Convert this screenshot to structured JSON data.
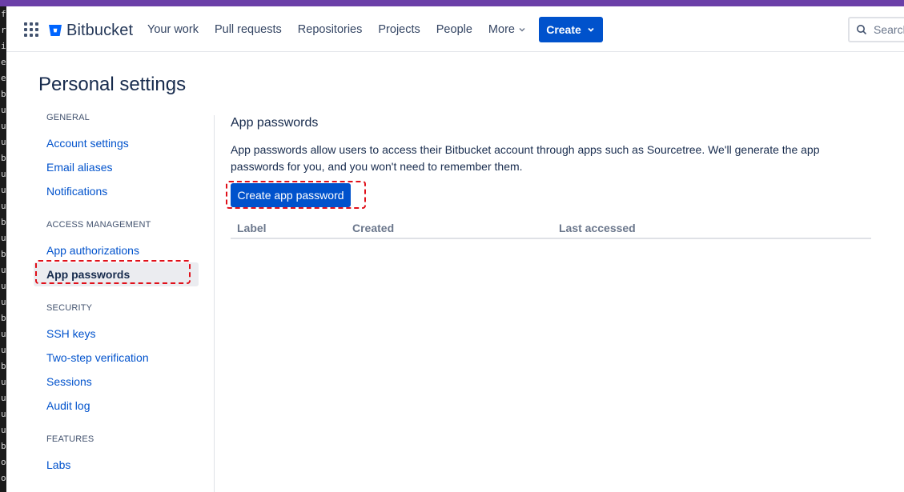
{
  "left_strip_chars": [
    "fa",
    "ro",
    "if",
    "e",
    "es",
    "b",
    "u",
    "u",
    "u",
    "b",
    "u",
    "u",
    "u",
    "b",
    "u",
    "b",
    "u",
    "u",
    "u",
    "b",
    "u",
    "u",
    "b",
    "u",
    "u",
    "u",
    "u",
    "b",
    "o",
    "o"
  ],
  "header": {
    "logo_text": "Bitbucket",
    "nav": [
      "Your work",
      "Pull requests",
      "Repositories",
      "Projects",
      "People"
    ],
    "more_label": "More",
    "create_label": "Create",
    "search_placeholder": "Search"
  },
  "page_title": "Personal settings",
  "sidebar": {
    "sections": [
      {
        "heading": "GENERAL",
        "items": [
          "Account settings",
          "Email aliases",
          "Notifications"
        ]
      },
      {
        "heading": "ACCESS MANAGEMENT",
        "items": [
          "App authorizations",
          "App passwords"
        ]
      },
      {
        "heading": "SECURITY",
        "items": [
          "SSH keys",
          "Two-step verification",
          "Sessions",
          "Audit log"
        ]
      },
      {
        "heading": "FEATURES",
        "items": [
          "Labs"
        ]
      }
    ],
    "active_item": "App passwords"
  },
  "content": {
    "title": "App passwords",
    "description": "App passwords allow users to access their Bitbucket account through apps such as Sourcetree. We'll generate the app passwords for you, and you won't need to remember them.",
    "create_button": "Create app password",
    "table_columns": [
      "Label",
      "Created",
      "Last accessed"
    ]
  },
  "colors": {
    "accent_bar": "#6b3fa8",
    "brand_blue": "#0052cc",
    "highlight_red": "#e0101a"
  }
}
